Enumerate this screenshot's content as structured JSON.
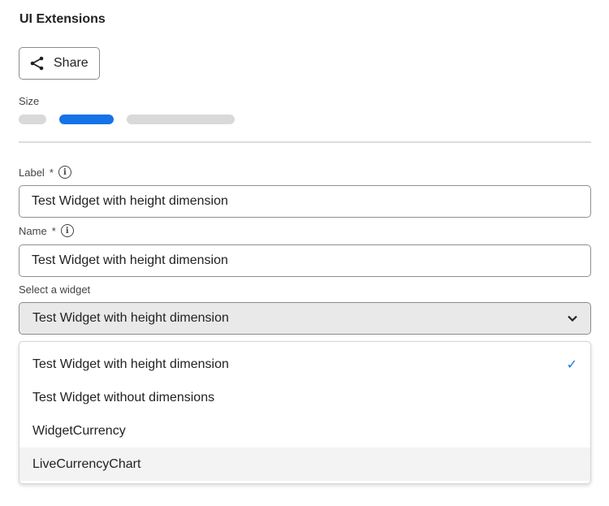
{
  "header": {
    "title": "UI Extensions"
  },
  "share": {
    "label": "Share",
    "icon": "share-icon"
  },
  "size": {
    "label": "Size",
    "options": [
      "small",
      "medium",
      "large"
    ],
    "selected_index": 1,
    "accent": "#1473e6"
  },
  "label_field": {
    "label": "Label",
    "required": "*",
    "value": "Test Widget with height dimension"
  },
  "name_field": {
    "label": "Name",
    "required": "*",
    "value": "Test Widget with height dimension"
  },
  "widget_select": {
    "label": "Select a widget",
    "value": "Test Widget with height dimension",
    "options": [
      {
        "label": "Test Widget with height dimension",
        "selected": true
      },
      {
        "label": "Test Widget without dimensions"
      },
      {
        "label": "WidgetCurrency"
      },
      {
        "label": "LiveCurrencyChart",
        "hovered": true
      }
    ]
  }
}
